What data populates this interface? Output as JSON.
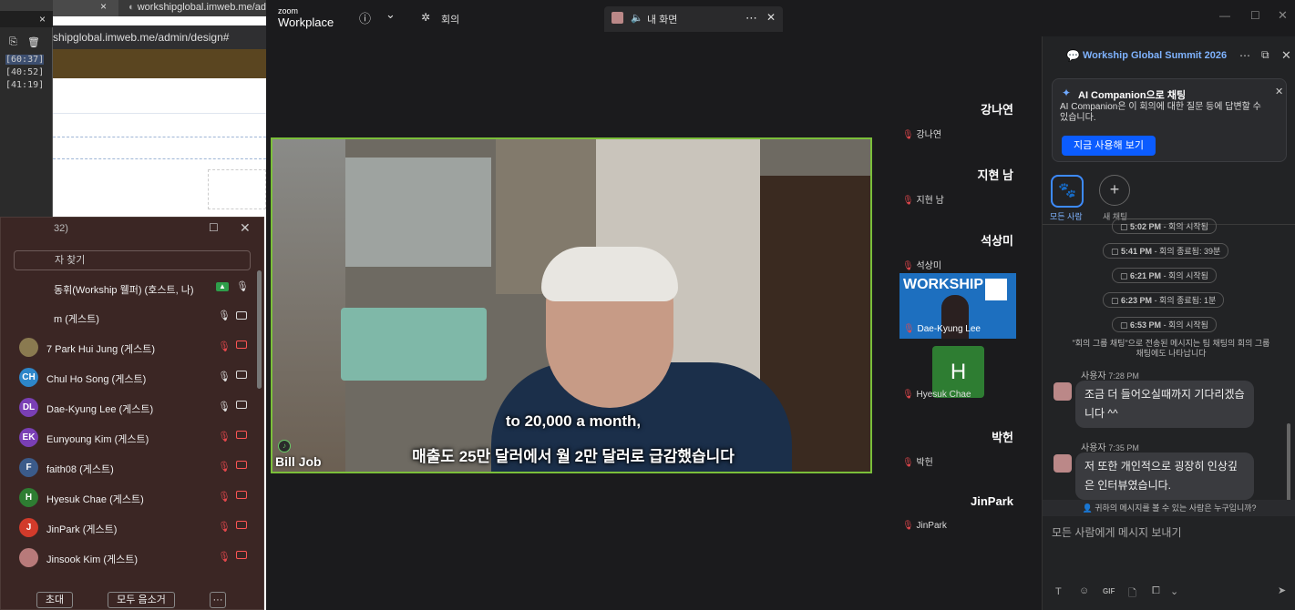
{
  "browser": {
    "tab1_close": "×",
    "tab2_title": "workshipglobal.imweb.me/admin",
    "url": "shipglobal.imweb.me/admin/design#"
  },
  "panel": {
    "close": "×",
    "timecodes": [
      "[60:37]",
      "[40:52]",
      "[41:19]"
    ]
  },
  "participants": {
    "count_suffix": "32)",
    "search_placeholder": "자 찾기",
    "host": "동휘(Workship 웰퍼) (호스트, 나)",
    "guest_partial": "m (게스트)",
    "list": [
      {
        "initials": "",
        "name": "7 Park Hui Jung (게스트)",
        "color": "#8a7a50",
        "muted": true
      },
      {
        "initials": "CH",
        "name": "Chul Ho Song (게스트)",
        "color": "#2d86c9",
        "muted": false
      },
      {
        "initials": "DL",
        "name": "Dae-Kyung Lee (게스트)",
        "color": "#7a3fb5",
        "muted": false
      },
      {
        "initials": "EK",
        "name": "Eunyoung Kim (게스트)",
        "color": "#7a3fb5",
        "muted": true
      },
      {
        "initials": "F",
        "name": "faith08 (게스트)",
        "color": "#3b5b8a",
        "muted": true
      },
      {
        "initials": "H",
        "name": "Hyesuk Chae (게스트)",
        "color": "#2e7d32",
        "muted": true
      },
      {
        "initials": "J",
        "name": "JinPark (게스트)",
        "color": "#d23b2b",
        "muted": true
      },
      {
        "initials": "",
        "name": "Jinsook Kim (게스트)",
        "color": "#b87a7a",
        "muted": true
      }
    ],
    "invite": "초대",
    "mute_all": "모두 음소거",
    "more": "···"
  },
  "zoom": {
    "logo_small": "zoom",
    "logo_big": "Workplace",
    "meeting_tab": "회의",
    "screen_tab": "내 화면",
    "info_icon": "ⓘ",
    "chev": "⌄",
    "speaker": "Bill Job",
    "caption1": "to 20,000 a month,",
    "caption2": "매출도 25만 달러에서 월 2만 달러로 급감했습니다",
    "side": [
      {
        "big": "강나연",
        "small": "강나연"
      },
      {
        "big": "지현 남",
        "small": "지현 남"
      },
      {
        "big": "석상미",
        "small": "석상미"
      },
      {
        "big": "",
        "small": "Dae-Kyung Lee"
      },
      {
        "big": "H",
        "small": "Hyesuk Chae"
      },
      {
        "big": "박헌",
        "small": "박헌"
      },
      {
        "big": "JinPark",
        "small": "JinPark"
      }
    ],
    "workship_banner": "WORKSHIP"
  },
  "chat": {
    "title": "Workship Global Summit 2026",
    "ai_title": "AI Companion으로 채팅",
    "ai_body": "AI Companion은 이 회의에 대한 질문 등에 답변할 수 있습니다.",
    "ai_btn": "지금 사용해 보기",
    "all_label": "모든 사람",
    "new_label": "새 채팅",
    "sys": [
      {
        "time": "5:02 PM",
        "text": "- 회의 시작됨"
      },
      {
        "time": "5:41 PM",
        "text": "- 회의 종료됨: 39분"
      },
      {
        "time": "6:21 PM",
        "text": "- 회의 시작됨"
      },
      {
        "time": "6:23 PM",
        "text": "- 회의 종료됨: 1분"
      },
      {
        "time": "6:53 PM",
        "text": "- 회의 시작됨"
      }
    ],
    "note": "\"회의 그룹 채팅\"으로 전송된 메시지는 팀 채팅의 회의 그룹 채팅에도 나타납니다",
    "messages": [
      {
        "sender": "사용자",
        "time": "7:28 PM",
        "text": "조금 더 들어오실때까지 기다리겠습니다 ^^"
      },
      {
        "sender": "사용자",
        "time": "7:35 PM",
        "text": "저 또한 개인적으로 굉장히 인상깊은 인터뷰였습니다."
      }
    ],
    "who_can_see": "귀하의 메시지를 볼 수 있는 사람은 누구입니까?",
    "input_placeholder": "모든 사람에게 메시지 보내기",
    "gif": "GIF"
  }
}
